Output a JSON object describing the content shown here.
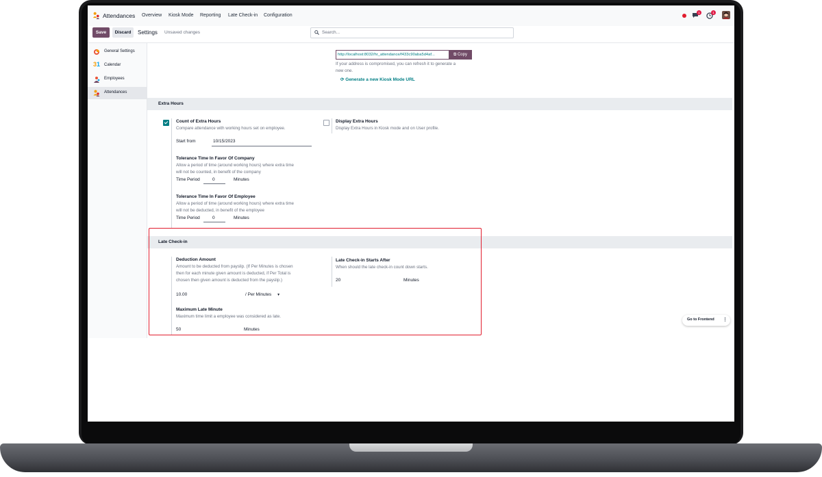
{
  "navbar": {
    "app_name": "Attendances",
    "menu": [
      "Overview",
      "Kiosk Mode",
      "Reporting",
      "Late Check-in",
      "Configuration"
    ],
    "messages_count": "1",
    "activity_count": "1"
  },
  "controlbar": {
    "save": "Save",
    "discard": "Discard",
    "breadcrumb": "Settings",
    "unsaved": "Unsaved changes",
    "search_placeholder": "Search..."
  },
  "sidebar": {
    "items": [
      {
        "label": "General Settings",
        "icon": "odoo-logo-icon"
      },
      {
        "label": "Calendar",
        "icon": "calendar-icon"
      },
      {
        "label": "Employees",
        "icon": "employees-icon"
      },
      {
        "label": "Attendances",
        "icon": "attendances-icon"
      }
    ]
  },
  "kiosk": {
    "url": "http://localhost:8032/hr_attendance/f433c90aba5d4af...",
    "copy": "Copy",
    "note_line1": "If your address is compromised, you can refresh it to generate a",
    "note_line2": "new one.",
    "generate_link": "Generate a new Kiosk Mode URL"
  },
  "extra_hours": {
    "header": "Extra Hours",
    "count_title": "Count of Extra Hours",
    "count_desc": "Compare attendance with working hours set on employee.",
    "count_checked": true,
    "start_label": "Start from",
    "start_value": "10/15/2023",
    "tol_company_title": "Tolerance Time In Favor Of Company",
    "tol_company_desc1": "Allow a period of time (around working hours) where extra time",
    "tol_company_desc2": "will not be counted, in benefit of the company",
    "tol_company_period_label": "Time Period",
    "tol_company_period_value": "0",
    "tol_company_unit": "Minutes",
    "tol_employee_title": "Tolerance Time In Favor Of Employee",
    "tol_employee_desc1": "Allow a period of time (around working hours) where extra time",
    "tol_employee_desc2": "will not be deducted, in benefit of the employee",
    "tol_employee_period_label": "Time Period",
    "tol_employee_period_value": "0",
    "tol_employee_unit": "Minutes",
    "display_title": "Display Extra Hours",
    "display_desc": "Display Extra Hours in Kiosk mode and on User profile.",
    "display_checked": false
  },
  "late_checkin": {
    "header": "Late Check-in",
    "deduction_title": "Deduction Amount",
    "deduction_desc1": "Amount to be deducted from payslip. (If Per Minutes is chosen",
    "deduction_desc2": "then for each minute given amount is deducted, if Per Total is",
    "deduction_desc3": "chosen then given amount is deducted from the payslip.)",
    "deduction_value": "10.00",
    "deduction_mode": "/ Per Minutes",
    "max_title": "Maximum Late Minute",
    "max_desc": "Maximum time limit a employee was considered as late.",
    "max_value": "50",
    "max_unit": "Minutes",
    "starts_title": "Late Check-in Starts After",
    "starts_desc": "When should the late check-in count down starts.",
    "starts_value": "20",
    "starts_unit": "Minutes"
  },
  "frontend": {
    "label": "Go to Frontend"
  },
  "colors": {
    "brand": "#714B67",
    "accent": "#017e84",
    "highlight": "#e11d2e"
  }
}
